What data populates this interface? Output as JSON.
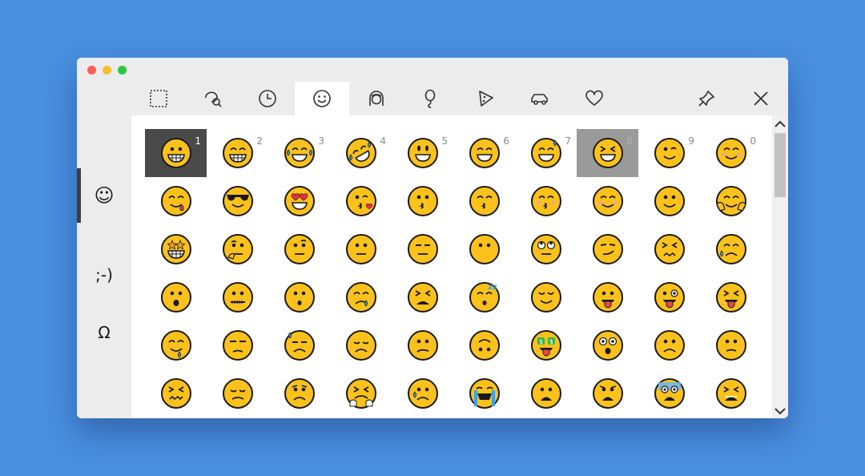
{
  "window": {
    "traffic_lights": [
      "close",
      "minimize",
      "zoom"
    ]
  },
  "sidebar": {
    "items": [
      {
        "label": "☺",
        "icon": "smiley-icon",
        "active": true
      },
      {
        "label": ";-)",
        "icon": "kaomoji-icon",
        "active": false
      },
      {
        "label": "Ω",
        "icon": "symbols-icon",
        "active": false
      }
    ]
  },
  "tabs": [
    {
      "icon": "recent-frame-icon",
      "active": false
    },
    {
      "icon": "search-icon",
      "active": false
    },
    {
      "icon": "clock-icon",
      "active": false
    },
    {
      "icon": "smiley-icon",
      "active": true
    },
    {
      "icon": "person-icon",
      "active": false
    },
    {
      "icon": "balloon-icon",
      "active": false
    },
    {
      "icon": "pizza-icon",
      "active": false
    },
    {
      "icon": "car-icon",
      "active": false
    },
    {
      "icon": "heart-icon",
      "active": false
    }
  ],
  "toolbar": {
    "pin_icon": "pin-icon",
    "close_icon": "close-icon"
  },
  "grid": {
    "number_labels": [
      "1",
      "2",
      "3",
      "4",
      "5",
      "6",
      "7",
      "8",
      "9",
      "0"
    ],
    "selected_index": 0,
    "hover_index": 7,
    "rows": [
      [
        "grin",
        "grin-squint",
        "joy",
        "rofl",
        "grin-big",
        "smile",
        "sweat-smile",
        "laugh-squint",
        "wink",
        "blush"
      ],
      [
        "yum",
        "sunglasses",
        "heart-eyes",
        "kiss-heart",
        "kiss",
        "kiss-smile",
        "kiss-blush",
        "smiling",
        "slight-smile",
        "hug"
      ],
      [
        "star-struck",
        "thinking",
        "raised-brow",
        "neutral",
        "expressionless",
        "no-mouth",
        "eye-roll",
        "smirk",
        "persevere",
        "sad-relieved"
      ],
      [
        "open-mouth",
        "zipper",
        "hushed",
        "sleepy",
        "tired",
        "sleeping",
        "relieved",
        "tongue",
        "tongue-wink",
        "tongue-squint"
      ],
      [
        "drool",
        "unamused",
        "sweat",
        "pensive",
        "confused",
        "upside-down",
        "money-mouth",
        "astonished",
        "frown",
        "slight-frown"
      ],
      [
        "confounded",
        "disappointed",
        "worried",
        "triumph",
        "cry",
        "sob",
        "frowning-open",
        "anguished",
        "fearful",
        "weary"
      ]
    ]
  },
  "colors": {
    "background": "#4a8fe0",
    "emoji_fill": "#fcc21b",
    "selected_cell": "#4a4a4a",
    "hover_cell": "#9a9a9a"
  }
}
